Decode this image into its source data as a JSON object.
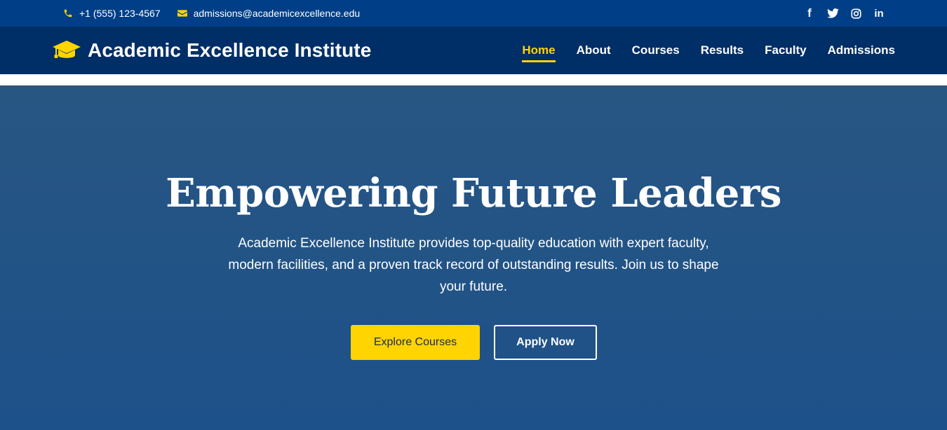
{
  "topbar": {
    "phone": "+1 (555) 123-4567",
    "email": "admissions@academicexcellence.edu",
    "social": [
      {
        "icon": "facebook-icon",
        "glyph": "f"
      },
      {
        "icon": "twitter-icon"
      },
      {
        "icon": "instagram-icon"
      },
      {
        "icon": "linkedin-icon",
        "glyph": "in"
      }
    ]
  },
  "header": {
    "brand_name": "Academic Excellence Institute",
    "brand_icon": "graduation-cap-icon",
    "nav": [
      "Home",
      "About",
      "Courses",
      "Results",
      "Faculty",
      "Admissions"
    ],
    "active_nav": "Home"
  },
  "hero": {
    "title": "Empowering Future Leaders",
    "description": "Academic Excellence Institute provides top-quality education with expert faculty, modern facilities, and a proven track record of outstanding results. Join us to shape your future.",
    "primary_button": "Explore Courses",
    "secondary_button": "Apply Now"
  },
  "colors": {
    "topbar_bg": "#003f87",
    "header_bg": "#002e66",
    "accent": "#ffd400",
    "hero_top": "#285683",
    "hero_bottom": "#1d5189"
  }
}
